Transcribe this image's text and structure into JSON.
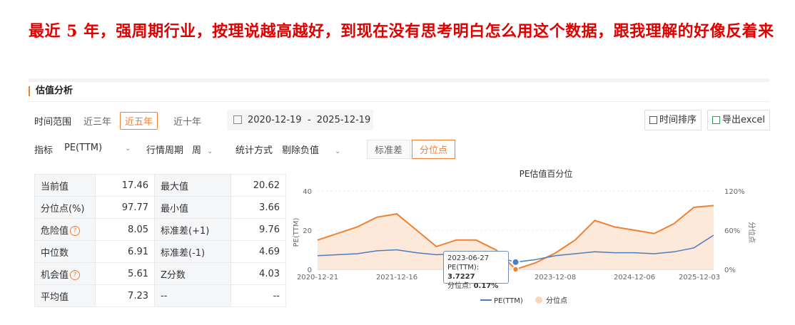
{
  "headline": "最近 5 年，强周期行业，按理说越高越好，到现在没有思考明白怎么用这个数据，跟我理解的好像反着来",
  "section_title": "估值分析",
  "filters": {
    "time_range_label": "时间范围",
    "time_options": [
      "近三年",
      "近五年",
      "近十年"
    ],
    "time_selected": "近五年",
    "date_range": "2020-12-19  -  2025-12-19",
    "sort_button": "时间排序",
    "export_button": "导出excel",
    "indicator_label": "指标",
    "indicator_value": "PE(TTM)",
    "period_label": "行情周期",
    "period_value": "周",
    "method_label": "统计方式",
    "method_value": "剔除负值",
    "toggle_options": [
      "标准差",
      "分位点"
    ],
    "toggle_selected": "分位点"
  },
  "stats": [
    {
      "k1": "当前值",
      "v1": "17.46",
      "k2": "最大值",
      "v2": "20.62"
    },
    {
      "k1": "分位点(%)",
      "v1": "97.77",
      "k2": "最小值",
      "v2": "3.66"
    },
    {
      "k1": "危险值",
      "v1": "8.05",
      "k2": "标准差(+1)",
      "v2": "9.76",
      "help1": true
    },
    {
      "k1": "中位数",
      "v1": "6.91",
      "k2": "标准差(-1)",
      "v2": "4.69"
    },
    {
      "k1": "机会值",
      "v1": "5.61",
      "k2": "Z分数",
      "v2": "4.03",
      "help1": true
    },
    {
      "k1": "平均值",
      "v1": "7.23",
      "k2": "--",
      "v2": "--"
    }
  ],
  "chart_data": {
    "type": "line",
    "title": "PE估值百分位",
    "ylabel": "PE(TTM)",
    "y2label": "分位点",
    "ylim": [
      0,
      40
    ],
    "y2lim": [
      0,
      120
    ],
    "yticks": [
      "0",
      "20",
      "40"
    ],
    "y2ticks": [
      "0%",
      "60%",
      "120%"
    ],
    "xtick_labels": [
      "2020-12-21",
      "2021-12-16",
      "2023-12-08",
      "2024-12-06",
      "2025-12-03"
    ],
    "x": [
      "2020-12",
      "2021-03",
      "2021-06",
      "2021-09",
      "2021-12",
      "2022-03",
      "2022-06",
      "2022-09",
      "2022-12",
      "2023-03",
      "2023-06",
      "2023-09",
      "2023-12",
      "2024-03",
      "2024-06",
      "2024-09",
      "2024-12",
      "2025-03",
      "2025-06",
      "2025-09",
      "2025-12"
    ],
    "series": [
      {
        "name": "PE(TTM)",
        "color": "#4a7ebf",
        "values": [
          7,
          7.5,
          8,
          9.5,
          10,
          8.5,
          7.5,
          8,
          7.5,
          6.5,
          3.72,
          5,
          7,
          8,
          9,
          8.5,
          8.5,
          8,
          9,
          11,
          17.46
        ]
      },
      {
        "name": "分位点",
        "color": "#f08133",
        "values": [
          45,
          55,
          65,
          80,
          85,
          60,
          35,
          45,
          45,
          30,
          0.17,
          10,
          25,
          45,
          75,
          65,
          60,
          55,
          70,
          95,
          97.77
        ]
      }
    ],
    "legend": [
      "PE(TTM)",
      "分位点"
    ],
    "legend_position": "bottom",
    "tooltip": {
      "date": "2023-06-27",
      "pe_label": "PE(TTM):",
      "pe_value": "3.7227",
      "pct_label": "分位点:",
      "pct_value": "0.17%"
    }
  }
}
